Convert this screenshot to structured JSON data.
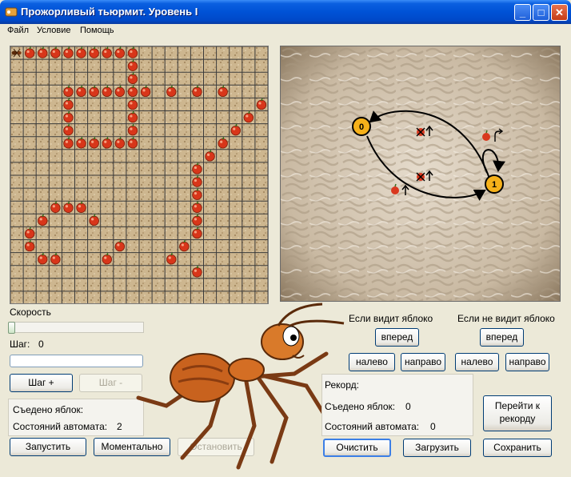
{
  "window": {
    "title": "Прожорливый тьюрмит. Уровень I",
    "minimize": "_",
    "maximize": "□",
    "close": "✕"
  },
  "menu": [
    "Файл",
    "Условие",
    "Помощь"
  ],
  "field": {
    "cols": 20,
    "rows": 20,
    "ant": [
      0,
      0
    ],
    "apples": [
      [
        0,
        1
      ],
      [
        0,
        2
      ],
      [
        0,
        3
      ],
      [
        0,
        4
      ],
      [
        0,
        5
      ],
      [
        0,
        6
      ],
      [
        0,
        7
      ],
      [
        0,
        8
      ],
      [
        0,
        9
      ],
      [
        1,
        9
      ],
      [
        2,
        9
      ],
      [
        3,
        4
      ],
      [
        3,
        5
      ],
      [
        3,
        6
      ],
      [
        3,
        7
      ],
      [
        3,
        8
      ],
      [
        3,
        9
      ],
      [
        3,
        10
      ],
      [
        3,
        12
      ],
      [
        3,
        14
      ],
      [
        3,
        16
      ],
      [
        4,
        4
      ],
      [
        4,
        9
      ],
      [
        4,
        19
      ],
      [
        5,
        4
      ],
      [
        5,
        9
      ],
      [
        5,
        18
      ],
      [
        6,
        4
      ],
      [
        6,
        9
      ],
      [
        6,
        17
      ],
      [
        7,
        4
      ],
      [
        7,
        5
      ],
      [
        7,
        6
      ],
      [
        7,
        7
      ],
      [
        7,
        8
      ],
      [
        7,
        9
      ],
      [
        7,
        16
      ],
      [
        8,
        15
      ],
      [
        9,
        14
      ],
      [
        10,
        14
      ],
      [
        11,
        14
      ],
      [
        12,
        3
      ],
      [
        12,
        4
      ],
      [
        12,
        5
      ],
      [
        12,
        14
      ],
      [
        13,
        2
      ],
      [
        13,
        6
      ],
      [
        13,
        14
      ],
      [
        14,
        1
      ],
      [
        14,
        14
      ],
      [
        15,
        1
      ],
      [
        15,
        8
      ],
      [
        15,
        13
      ],
      [
        16,
        2
      ],
      [
        16,
        3
      ],
      [
        16,
        7
      ],
      [
        16,
        12
      ],
      [
        17,
        14
      ]
    ]
  },
  "maze_diagram": {
    "state0": "0",
    "state1": "1"
  },
  "controls": {
    "speed_label": "Скорость",
    "speed_value": 0.0,
    "step_label": "Шаг:",
    "step_value": "0",
    "step_plus": "Шаг +",
    "step_minus": "Шаг -",
    "eaten_label": "Съедено яблок:",
    "states_label": "Состояний автомата:",
    "states_value": "2",
    "run": "Запустить",
    "instant": "Моментально",
    "stop": "Остановить"
  },
  "automaton": {
    "sees_apple": "Если видит яблоко",
    "no_apple": "Если не видит яблоко",
    "forward": "вперед",
    "left": "налево",
    "right": "направо"
  },
  "record": {
    "title": "Рекорд:",
    "eaten_label": "Съедено яблок:",
    "eaten_value": "0",
    "states_label": "Состояний автомата:",
    "states_value": "0",
    "goto": "Перейти к рекорду"
  },
  "bottom": {
    "clear": "Очистить",
    "load": "Загрузить",
    "save": "Сохранить"
  }
}
